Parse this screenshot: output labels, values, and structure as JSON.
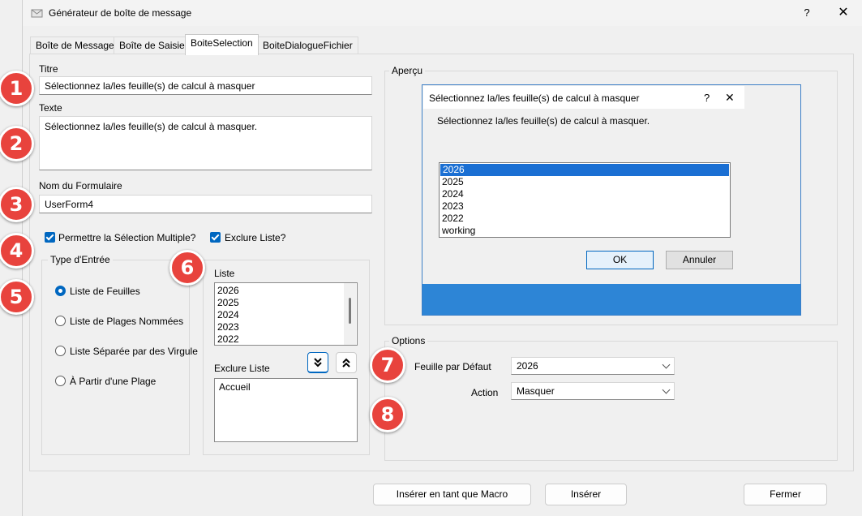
{
  "window": {
    "title": "Générateur de boîte de message",
    "help": "?",
    "close": "✕"
  },
  "tabs": [
    {
      "label": "Boîte de Message"
    },
    {
      "label": "Boîte de Saisie"
    },
    {
      "label": "BoiteSelection"
    },
    {
      "label": "BoiteDialogueFichier"
    }
  ],
  "form": {
    "titre_label": "Titre",
    "titre_value": "Sélectionnez la/les feuille(s) de calcul à masquer",
    "texte_label": "Texte",
    "texte_value": "Sélectionnez la/les feuille(s) de calcul à masquer.",
    "nom_label": "Nom du Formulaire",
    "nom_value": "UserForm4",
    "multi_select_label": "Permettre la Sélection Multiple?",
    "exclure_liste_check_label": "Exclure Liste?",
    "type_entree_title": "Type d'Entrée",
    "radios": [
      {
        "label": "Liste de Feuilles",
        "selected": true
      },
      {
        "label": "Liste de Plages Nommées",
        "selected": false
      },
      {
        "label": "Liste Séparée par des Virgule",
        "selected": false
      },
      {
        "label": "À Partir d'une Plage",
        "selected": false
      }
    ],
    "liste_label": "Liste",
    "liste_items": [
      "2026",
      "2025",
      "2024",
      "2023",
      "2022"
    ],
    "exclure_label": "Exclure Liste",
    "exclure_items": [
      "Accueil"
    ]
  },
  "preview": {
    "title": "Aperçu",
    "dialog_title": "Sélectionnez la/les feuille(s) de calcul à masquer",
    "dialog_help": "?",
    "dialog_close": "✕",
    "dialog_text": "Sélectionnez la/les feuille(s) de calcul à masquer.",
    "items": [
      "2026",
      "2025",
      "2024",
      "2023",
      "2022",
      "working"
    ],
    "ok_label": "OK",
    "cancel_label": "Annuler"
  },
  "options": {
    "title": "Options",
    "feuille_label": "Feuille par Défaut",
    "feuille_value": "2026",
    "action_label": "Action",
    "action_value": "Masquer"
  },
  "buttons": {
    "insert_macro": "Insérer en tant que Macro",
    "insert": "Insérer",
    "close": "Fermer"
  },
  "badges": [
    "1",
    "2",
    "3",
    "4",
    "5",
    "6",
    "7",
    "8"
  ],
  "colors": {
    "accent": "#0067c0",
    "badge": "#e8433d",
    "preview_bar": "#2d85d6",
    "selection": "#1a6fd3"
  }
}
